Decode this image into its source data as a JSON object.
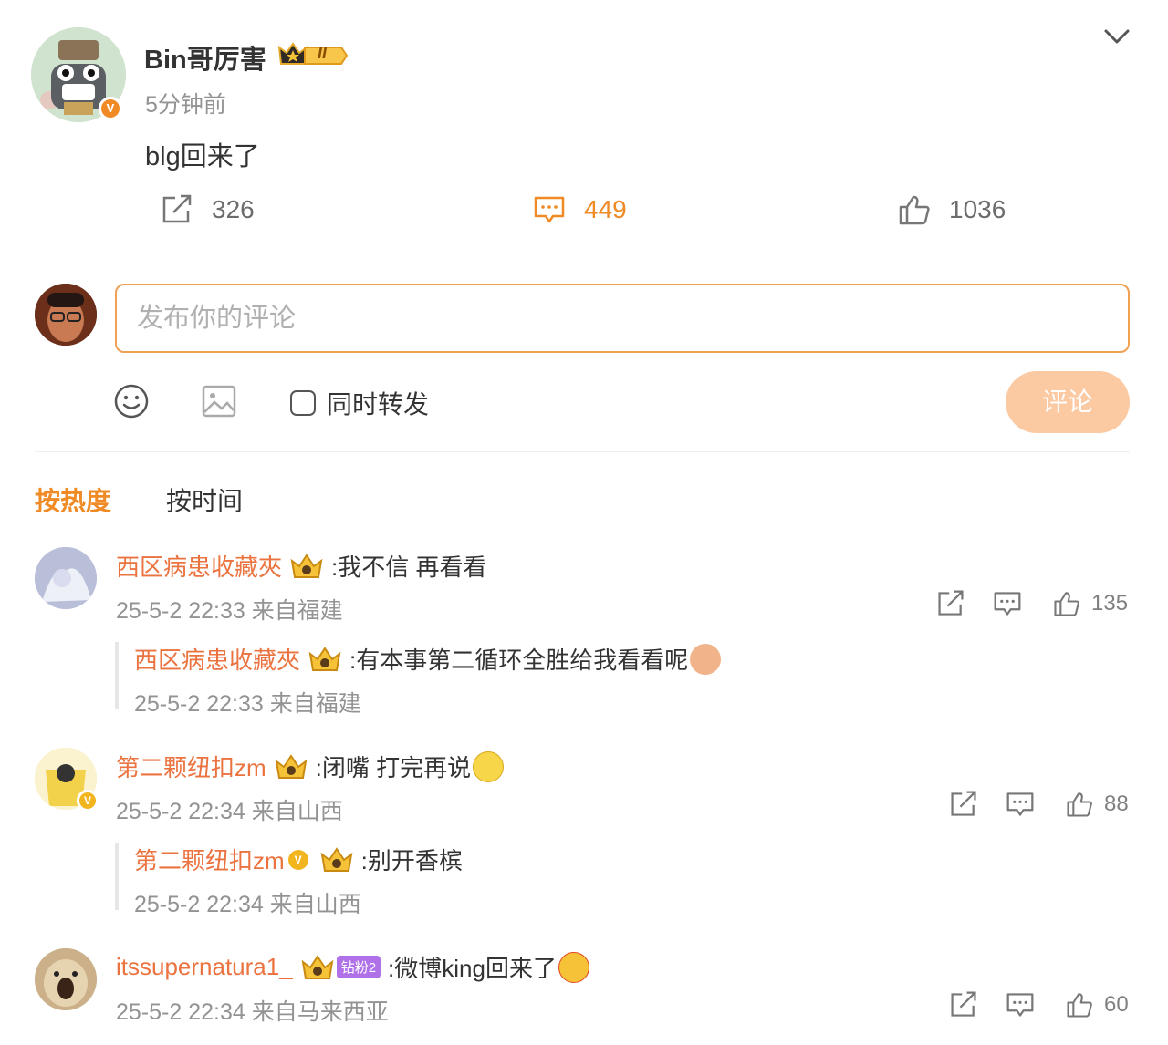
{
  "post": {
    "username": "Bin哥厉害",
    "level_badge": "II",
    "time": "5分钟前",
    "text": "blg回来了",
    "reposts": "326",
    "comments": "449",
    "likes": "1036"
  },
  "composer": {
    "placeholder": "发布你的评论",
    "also_repost_label": "同时转发",
    "submit_label": "评论"
  },
  "sort_tabs": {
    "hot": "按热度",
    "time": "按时间"
  },
  "comments": [
    {
      "name": "西区病患收藏夾",
      "text": ":我不信 再看看",
      "meta": "25-5-2 22:33 来自福建",
      "likes": "135",
      "reply": {
        "name": "西区病患收藏夾",
        "text": ":有本事第二循环全胜给我看看呢",
        "meta": "25-5-2 22:33 来自福建"
      }
    },
    {
      "name": "第二颗纽扣zm",
      "text": ":闭嘴 打完再说",
      "meta": "25-5-2 22:34 来自山西",
      "likes": "88",
      "reply": {
        "name": "第二颗纽扣zm",
        "text": ":别开香槟",
        "meta": "25-5-2 22:34 来自山西"
      }
    },
    {
      "name": "itssupernatura1_",
      "fan_tag": "钻粉2",
      "text": ":微博king回来了",
      "meta": "25-5-2 22:34 来自马来西亚",
      "likes": "60"
    }
  ],
  "colors": {
    "accent": "#f08a24",
    "name": "#eb7340",
    "button_disabled": "#fbc9a2"
  }
}
